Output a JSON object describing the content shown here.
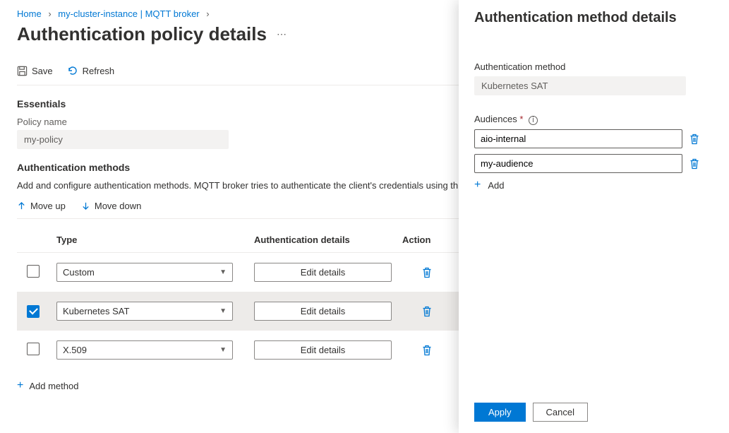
{
  "breadcrumb": {
    "home": "Home",
    "cluster": "my-cluster-instance | MQTT broker"
  },
  "page_title": "Authentication policy details",
  "toolbar": {
    "save": "Save",
    "refresh": "Refresh"
  },
  "essentials": {
    "heading": "Essentials",
    "policy_name_label": "Policy name",
    "policy_name_value": "my-policy"
  },
  "methods": {
    "heading": "Authentication methods",
    "description": "Add and configure authentication methods. MQTT broker tries to authenticate the client's credentials using th",
    "move_up": "Move up",
    "move_down": "Move down",
    "columns": {
      "type": "Type",
      "auth": "Authentication details",
      "action": "Action"
    },
    "edit_label": "Edit details",
    "rows": [
      {
        "type": "Custom",
        "selected": false
      },
      {
        "type": "Kubernetes SAT",
        "selected": true
      },
      {
        "type": "X.509",
        "selected": false
      }
    ],
    "add_label": "Add method"
  },
  "panel": {
    "title": "Authentication method details",
    "auth_method_label": "Authentication method",
    "auth_method_value": "Kubernetes SAT",
    "audiences_label": "Audiences",
    "audiences": [
      "aio-internal",
      "my-audience"
    ],
    "add_audience_label": "Add",
    "apply": "Apply",
    "cancel": "Cancel"
  }
}
